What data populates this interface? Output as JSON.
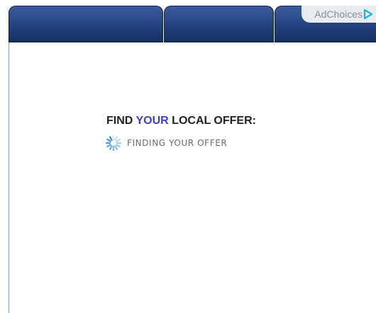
{
  "tabs": [
    {
      "label": ""
    },
    {
      "label": ""
    },
    {
      "label": ""
    }
  ],
  "ad_badge": {
    "label": "AdChoices",
    "icon": "adchoices-triangle-icon",
    "color": "#27b5d8"
  },
  "offer": {
    "heading_before": "FIND ",
    "heading_accent": "YOUR",
    "heading_after": " LOCAL OFFER:",
    "status_text": "FINDING YOUR OFFER",
    "spinner_icon": "loading-spinner-icon"
  },
  "colors": {
    "tab": "#23427f",
    "accent": "#3b3fd6",
    "spinner": "#3f8fd8"
  }
}
